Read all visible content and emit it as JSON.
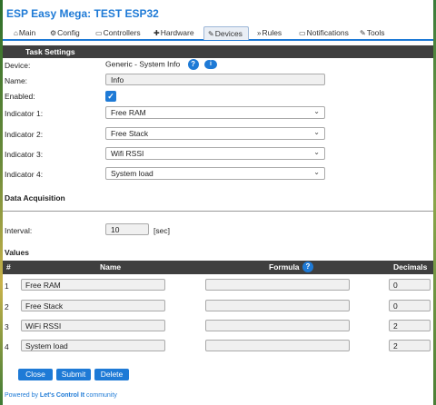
{
  "app": {
    "title": "ESP Easy Mega: TEST ESP32"
  },
  "tabs": [
    {
      "icon": "⌂",
      "label": "Main"
    },
    {
      "icon": "⚙",
      "label": "Config"
    },
    {
      "icon": "▭",
      "label": "Controllers"
    },
    {
      "icon": "✚",
      "label": "Hardware"
    },
    {
      "icon": "✎",
      "label": "Devices"
    },
    {
      "icon": "»",
      "label": "Rules"
    },
    {
      "icon": "▭",
      "label": "Notifications"
    },
    {
      "icon": "✎",
      "label": "Tools"
    }
  ],
  "task_settings": {
    "header": "Task Settings",
    "device_label": "Device:",
    "device_value": "Generic - System Info",
    "name_label": "Name:",
    "name_value": "Info",
    "enabled_label": "Enabled:",
    "enabled_checked": true,
    "indicators": [
      {
        "label": "Indicator 1:",
        "value": "Free RAM"
      },
      {
        "label": "Indicator 2:",
        "value": "Free Stack"
      },
      {
        "label": "Indicator 3:",
        "value": "Wifi RSSI"
      },
      {
        "label": "Indicator 4:",
        "value": "System load"
      }
    ]
  },
  "data_acquisition": {
    "title": "Data Acquisition",
    "interval_label": "Interval:",
    "interval_value": "10",
    "interval_unit": "[sec]"
  },
  "values": {
    "title": "Values",
    "columns": {
      "num": "#",
      "name": "Name",
      "formula": "Formula",
      "decimals": "Decimals"
    },
    "rows": [
      {
        "num": "1",
        "name": "Free RAM",
        "formula": "",
        "decimals": "0"
      },
      {
        "num": "2",
        "name": "Free Stack",
        "formula": "",
        "decimals": "0"
      },
      {
        "num": "3",
        "name": "WiFi RSSI",
        "formula": "",
        "decimals": "2"
      },
      {
        "num": "4",
        "name": "System load",
        "formula": "",
        "decimals": "2"
      }
    ]
  },
  "buttons": {
    "close": "Close",
    "submit": "Submit",
    "delete": "Delete"
  },
  "footer": {
    "prefix": "Powered by ",
    "brand": "Let's Control It",
    "suffix": " community"
  },
  "colors": {
    "accent": "#1e7ad6",
    "header_bg": "#3f3f3f"
  }
}
